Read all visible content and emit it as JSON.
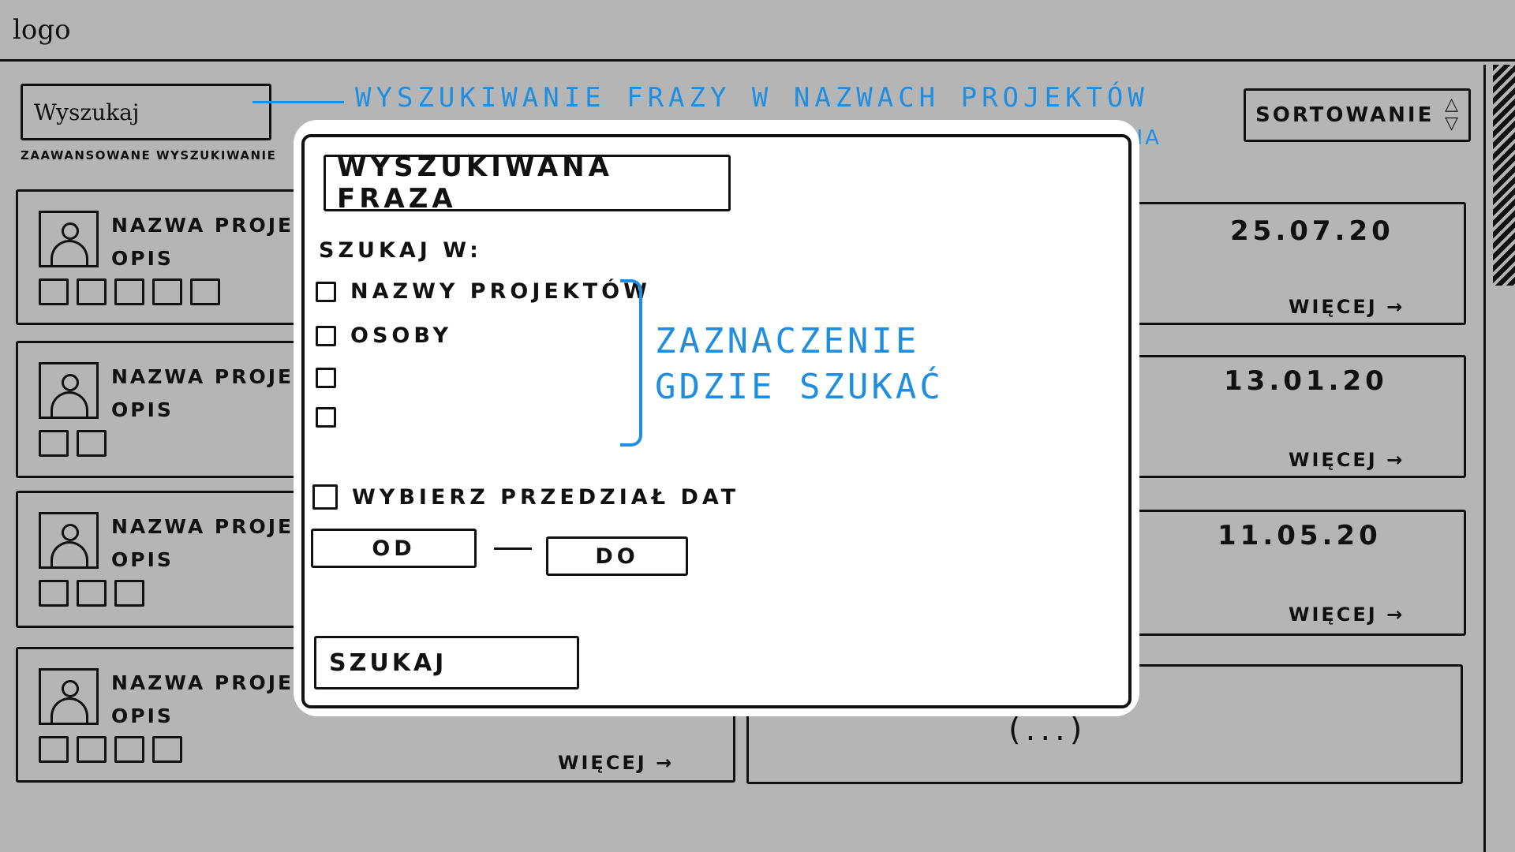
{
  "header": {
    "logo": "logo",
    "search_placeholder": "Wyszukaj",
    "advanced_search": "ZAAWANSOWANE WYSZUKIWANIE",
    "sort_label": "SORTOWANIE",
    "sort_icon": "sort-updown-icon"
  },
  "annotations": {
    "search": "WYSZUKIWANIE FRAZY W NAZWACH PROJEKTÓW",
    "sort_tail": "NIA",
    "checkbox_group_line1": "ZAZNACZENIE",
    "checkbox_group_line2": "GDZIE SZUKAĆ",
    "accent_color": "#1f8ee0"
  },
  "cards_left": [
    {
      "name": "NAZWA PROJEKT",
      "desc": "OPIS",
      "tags": 5
    },
    {
      "name": "NAZWA PROJEKT",
      "desc": "OPIS",
      "tags": 2
    },
    {
      "name": "NAZWA PROJEKT",
      "desc": "OPIS",
      "tags": 3
    },
    {
      "name": "NAZWA PROJEKT",
      "desc": "OPIS",
      "tags": 4,
      "more": "WIĘCEJ →"
    }
  ],
  "cards_right": [
    {
      "date": "25.07.20",
      "more": "WIĘCEJ →"
    },
    {
      "date": "13.01.20",
      "more": "WIĘCEJ →"
    },
    {
      "date": "11.05.20",
      "more": "WIĘCEJ →"
    },
    {
      "ellipsis": "(...)"
    }
  ],
  "modal": {
    "phrase_placeholder": "WYSZUKIWANA FRAZA",
    "search_in_label": "SZUKAJ W:",
    "options": [
      "NAZWY PROJEKTÓW",
      "OSOBY",
      "",
      ""
    ],
    "date_range_label": "WYBIERZ PRZEDZIAŁ DAT",
    "from_label": "OD",
    "to_label": "DO",
    "search_button": "SZUKAJ"
  }
}
